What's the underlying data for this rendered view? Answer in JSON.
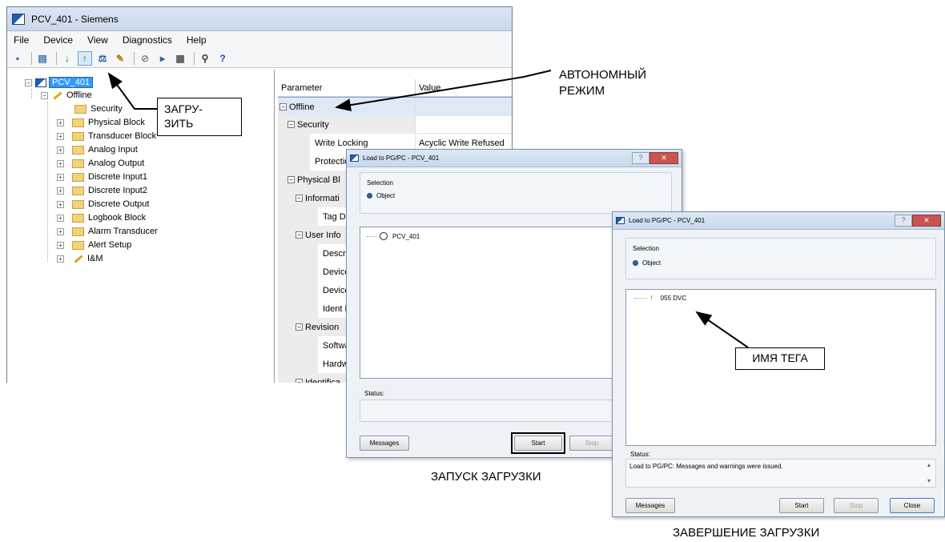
{
  "main_window": {
    "title": "PCV_401 - Siemens",
    "menu": [
      "File",
      "Device",
      "View",
      "Diagnostics",
      "Help"
    ],
    "tree": {
      "root": "PCV_401",
      "offline": "Offline",
      "items": [
        "Security",
        "Physical Block",
        "Transducer Block",
        "Analog Input",
        "Analog Output",
        "Discrete Input1",
        "Discrete Input2",
        "Discrete Output",
        "Logbook Block",
        "Alarm Transducer",
        "Alert Setup",
        "I&M"
      ]
    },
    "grid": {
      "col_parameter": "Parameter",
      "col_value": "Value",
      "rows": [
        {
          "param": "Offline",
          "value": "",
          "level": 0,
          "group": true
        },
        {
          "param": "Security",
          "value": "",
          "level": 1,
          "group": true
        },
        {
          "param": "Write Locking",
          "value": "Acyclic Write Refused",
          "level": 2,
          "group": false
        },
        {
          "param": "Protection",
          "value": "",
          "level": 2,
          "group": false
        },
        {
          "param": "Physical Bl",
          "value": "",
          "level": 1,
          "group": true
        },
        {
          "param": "Informati",
          "value": "",
          "level": 2,
          "group": true
        },
        {
          "param": "Tag Descr",
          "value": "",
          "level": 3,
          "group": false
        },
        {
          "param": "User Info",
          "value": "",
          "level": 2,
          "group": true
        },
        {
          "param": "Descriptor",
          "value": "",
          "level": 3,
          "group": false
        },
        {
          "param": "Device Me",
          "value": "",
          "level": 3,
          "group": false
        },
        {
          "param": "Device Ins",
          "value": "",
          "level": 3,
          "group": false
        },
        {
          "param": "Ident Num",
          "value": "",
          "level": 3,
          "group": false
        },
        {
          "param": "Revision",
          "value": "",
          "level": 2,
          "group": true
        },
        {
          "param": "Software R",
          "value": "",
          "level": 3,
          "group": false
        },
        {
          "param": "Hardware",
          "value": "",
          "level": 3,
          "group": false
        },
        {
          "param": "Identifica",
          "value": "",
          "level": 2,
          "group": true
        }
      ]
    }
  },
  "dialog1": {
    "title": "Load to PG/PC - PCV_401",
    "selection_label": "Selection",
    "object_label": "Object",
    "list_item": "PCV_401",
    "status_label": "Status:",
    "status_text": "",
    "messages_btn": "Messages",
    "start_btn": "Start",
    "stop_btn": "Stop"
  },
  "dialog2": {
    "title": "Load to PG/PC - PCV_401",
    "selection_label": "Selection",
    "object_label": "Object",
    "list_item": "055 DVC",
    "status_label": "Status:",
    "status_text": "Load to PG/PC: Messages and warnings were issued.",
    "messages_btn": "Messages",
    "start_btn": "Start",
    "stop_btn": "Stop",
    "close_btn": "Close"
  },
  "annotations": {
    "download": "ЗАГРУ-\nЗИТЬ",
    "offline_mode": "АВТОНОМНЫЙ\nРЕЖИМ",
    "tag_name": "ИМЯ ТЕГА",
    "start_download": "ЗАПУСК ЗАГРУЗКИ",
    "download_complete": "ЗАВЕРШЕНИЕ ЗАГРУЗКИ"
  }
}
